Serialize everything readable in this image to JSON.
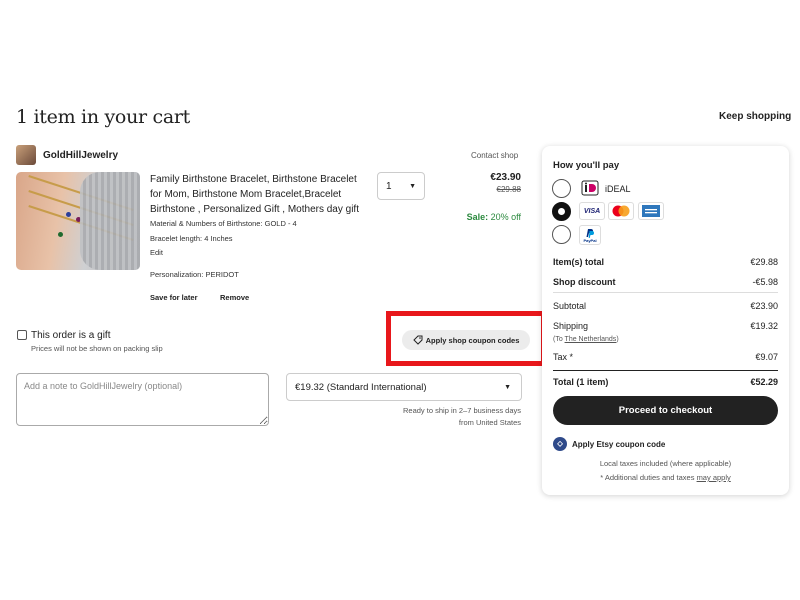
{
  "header": {
    "title": "1 item in your cart",
    "keep_shopping": "Keep shopping"
  },
  "shop": {
    "name": "GoldHillJewelry",
    "contact": "Contact shop"
  },
  "item": {
    "title": "Family Birthstone Bracelet, Birthstone Bracelet for Mom, Birthstone Mom Bracelet,Bracelet Birthstone , Personalized Gift , Mothers day gift",
    "material": "Material & Numbers of Birthstone: GOLD - 4",
    "length": "Bracelet length: 4 Inches",
    "edit": "Edit",
    "personalization": "Personalization: PERIDOT",
    "save_for_later": "Save for later",
    "remove": "Remove",
    "quantity": "1",
    "price": "€23.90",
    "original_price": "€29.88",
    "sale_label": "Sale:",
    "sale_value": "20% off"
  },
  "gift": {
    "label": "This order is a gift",
    "sub": "Prices will not be shown on packing slip"
  },
  "coupon_button": "Apply shop coupon codes",
  "note": {
    "placeholder": "Add a note to GoldHillJewelry (optional)"
  },
  "shipping": {
    "selected": "€19.32 (Standard International)",
    "ready_line1": "Ready to ship in 2–7 business days",
    "ready_line2": "from United States"
  },
  "payment": {
    "heading": "How you'll pay",
    "ideal_label": "iDEAL",
    "methods": [
      {
        "name": "ideal",
        "selected": false
      },
      {
        "name": "cards",
        "selected": true
      },
      {
        "name": "paypal",
        "selected": false
      }
    ],
    "visa": "VISA",
    "paypal": "PayPal"
  },
  "summary": {
    "items_total_label": "Item(s) total",
    "items_total_value": "€29.88",
    "discount_label": "Shop discount",
    "discount_value": "-€5.98",
    "subtotal_label": "Subtotal",
    "subtotal_value": "€23.90",
    "shipping_label": "Shipping",
    "shipping_value": "€19.32",
    "shipping_to_prefix": "(To ",
    "shipping_to_country": "The Netherlands",
    "shipping_to_suffix": ")",
    "tax_label": "Tax *",
    "tax_value": "€9.07",
    "total_label": "Total (1 item)",
    "total_value": "€52.29"
  },
  "checkout_button": "Proceed to checkout",
  "etsy_coupon": "Apply Etsy coupon code",
  "footnotes": {
    "local_taxes": "Local taxes included (where applicable)",
    "duties_prefix": "* Additional duties and taxes ",
    "duties_link": "may apply"
  },
  "colors": {
    "sale_green": "#2c8a3f",
    "highlight_red": "#e8171b",
    "checkout_bg": "#222222"
  },
  "icons": [
    "tag-icon",
    "chevron-down-icon",
    "ideal-logo-icon",
    "visa-logo-icon",
    "mastercard-logo-icon",
    "amex-logo-icon",
    "paypal-logo-icon",
    "etsy-coupon-icon"
  ]
}
